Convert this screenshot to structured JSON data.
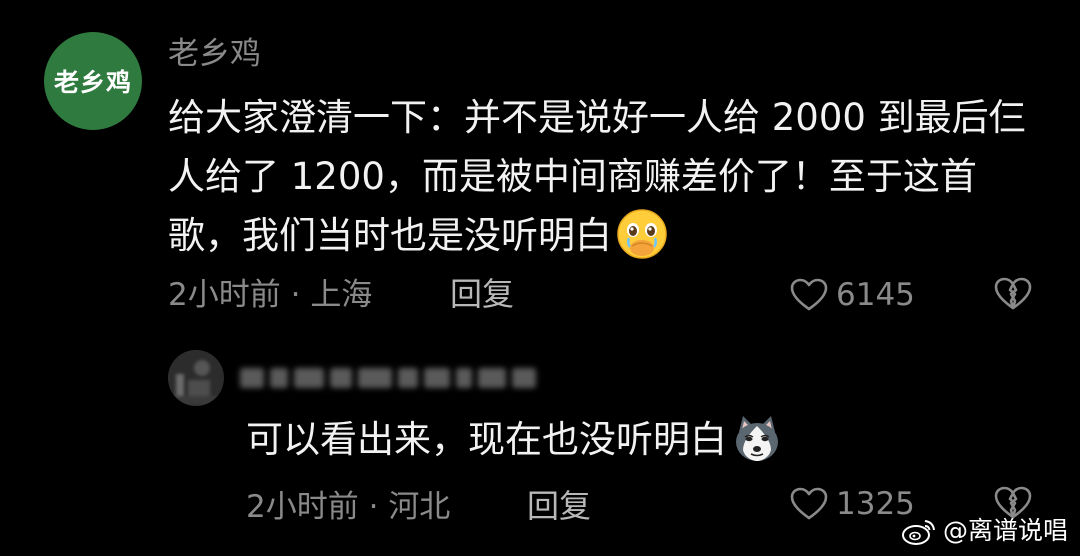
{
  "main_comment": {
    "avatar_text": "老乡鸡",
    "username": "老乡鸡",
    "content": "给大家澄清一下：并不是说好一人给 2000 到最后仨人给了 1200，而是被中间商赚差价了！至于这首歌，我们当时也是没听明白",
    "emoji": "face-holding-back-tears-emoji",
    "time": "2小时前",
    "separator": "·",
    "location": "上海",
    "reply_label": "回复",
    "like_count": "6145"
  },
  "reply_comment": {
    "content": "可以看出来，现在也没听明白",
    "emoji": "husky-dog-emoji",
    "time": "2小时前",
    "separator": "·",
    "location": "河北",
    "reply_label": "回复",
    "like_count": "1325"
  },
  "watermark": {
    "text": "@离谱说唱"
  },
  "colors": {
    "background": "#000000",
    "avatar_green": "#2f7a3e",
    "muted_text": "#8a8a8a",
    "body_text": "#f2f2f2"
  }
}
